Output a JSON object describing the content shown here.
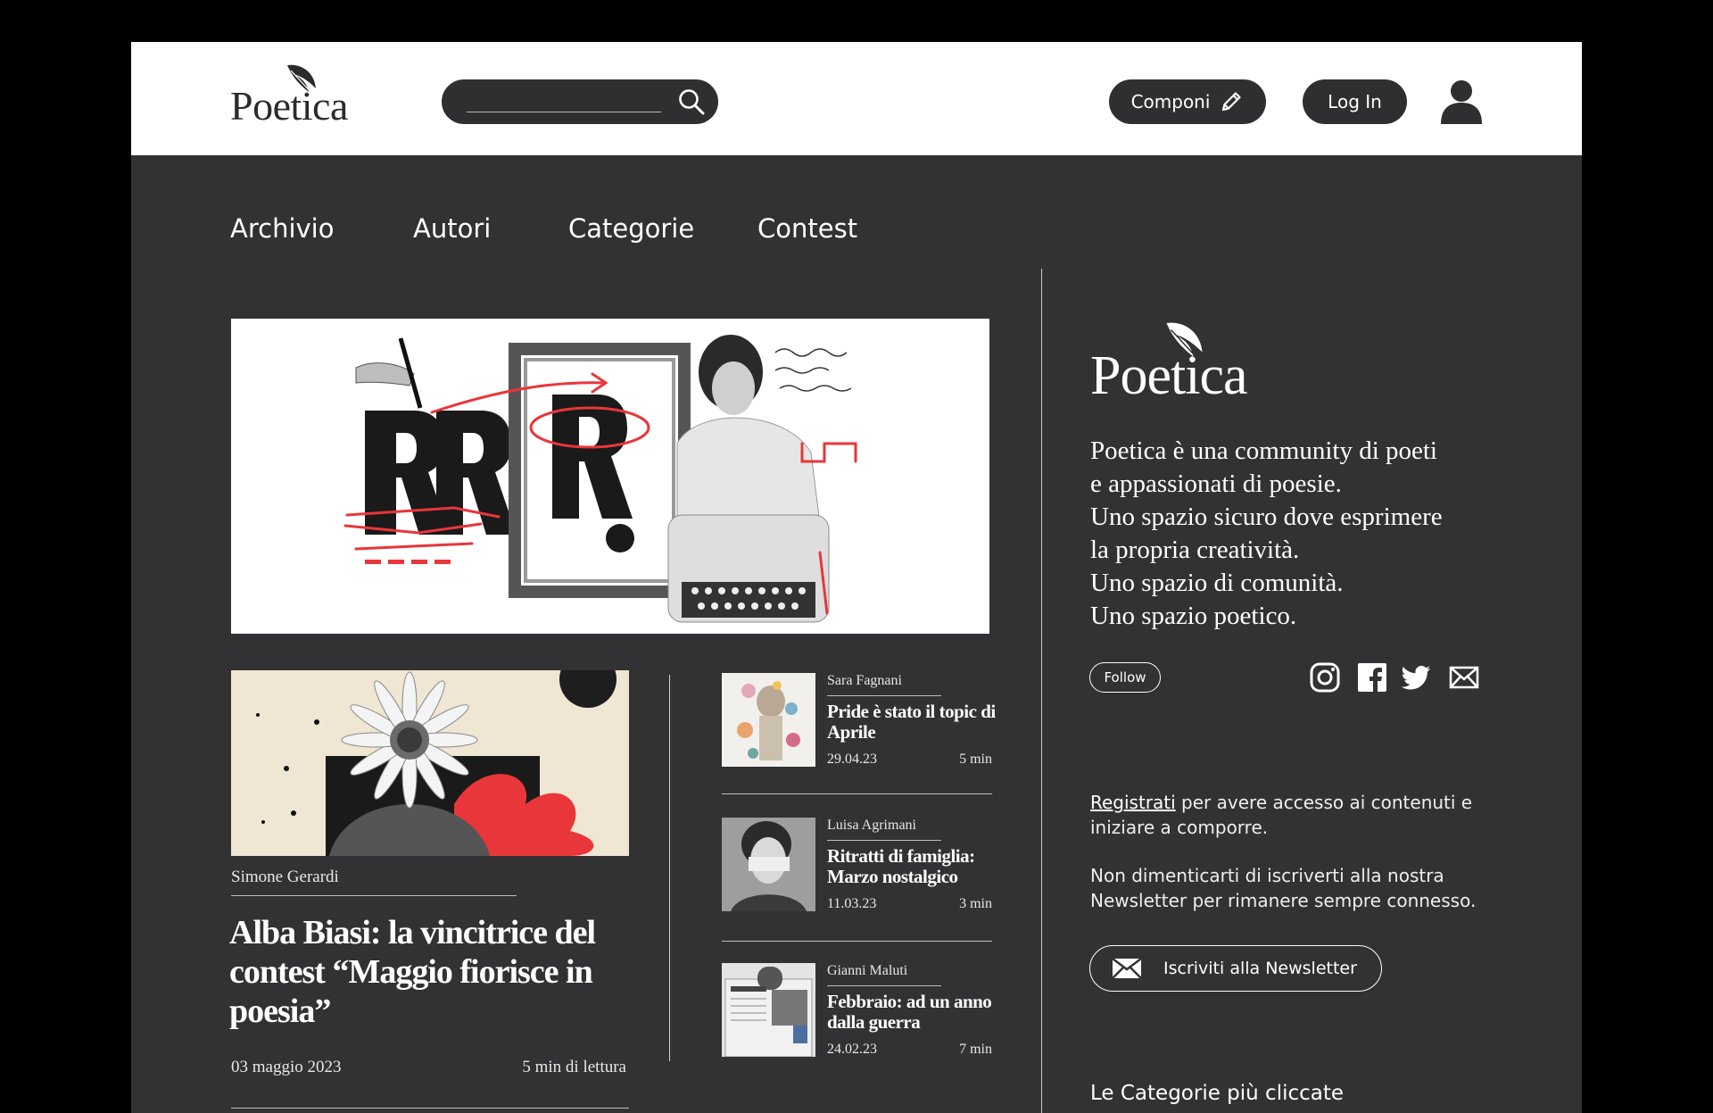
{
  "header": {
    "logo_text": "Poetica",
    "search_placeholder": "",
    "componi_label": "Componi",
    "login_label": "Log In"
  },
  "nav": {
    "items": [
      "Archivio",
      "Autori",
      "Categorie",
      "Contest"
    ]
  },
  "featured": {
    "author": "Simone Gerardi",
    "title": "Alba Biasi: la vincitrice del contest “Maggio fiorisce in poesia”",
    "date": "03 maggio 2023",
    "read_time": "5 min di lettura"
  },
  "articles": [
    {
      "author": "Sara Fagnani",
      "title": "Pride è stato il topic di Aprile",
      "date": "29.04.23",
      "read_time": "5 min"
    },
    {
      "author": "Luisa Agrimani",
      "title": "Ritratti di famiglia: Marzo nostalgico",
      "date": "11.03.23",
      "read_time": "3 min"
    },
    {
      "author": "Gianni Maluti",
      "title": "Febbraio: ad un anno dalla guerra",
      "date": "24.02.23",
      "read_time": "7 min"
    }
  ],
  "sidebar": {
    "logo_text": "Poetica",
    "description": [
      "Poetica è una community di poeti",
      "e appassionati di poesie.",
      "Uno spazio sicuro dove esprimere",
      "la propria creatività.",
      "Uno spazio di comunità.",
      "Uno spazio poetico."
    ],
    "follow_label": "Follow",
    "register_link": "Registrati",
    "register_text": " per avere accesso ai contenuti e iniziare a comporre.",
    "newsletter_text": "Non dimenticarti di iscriverti alla nostra Newsletter per rimanere sempre connesso.",
    "newsletter_button": "Iscriviti alla Newsletter",
    "categories_title": "Le Categorie più cliccate"
  },
  "colors": {
    "background": "#323234",
    "header": "#ffffff",
    "accent_red": "#e8363a",
    "pill": "#2f2f31"
  }
}
